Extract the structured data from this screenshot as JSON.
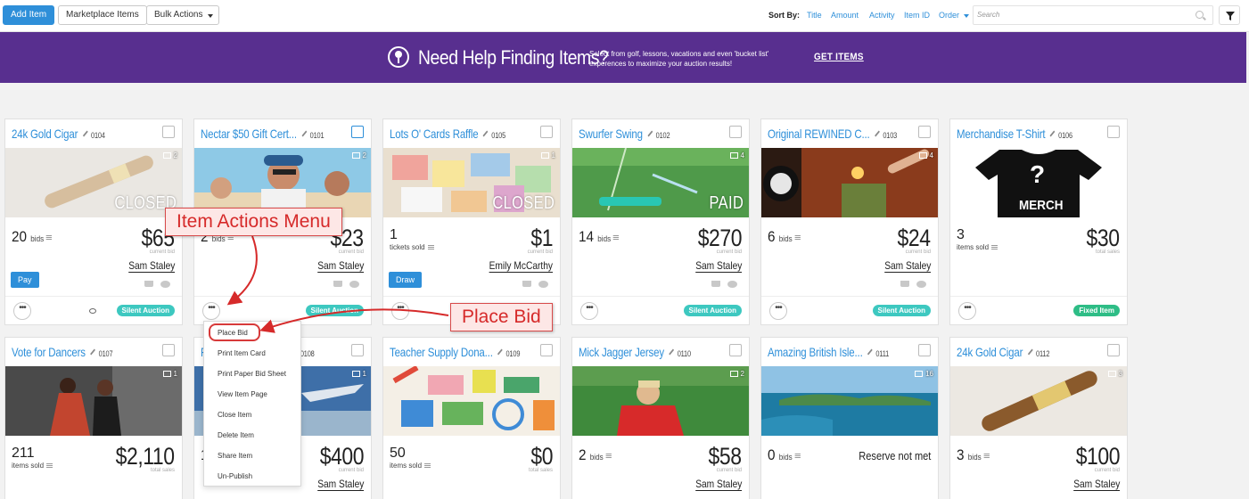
{
  "toolbar": {
    "add_item": "Add Item",
    "marketplace_items": "Marketplace Items",
    "bulk_actions": "Bulk Actions",
    "sort_by_label": "Sort By:",
    "sort_options": [
      "Title",
      "Amount",
      "Activity",
      "Item ID",
      "Order"
    ],
    "search_placeholder": "Search"
  },
  "banner": {
    "title": "Need Help Finding Items?",
    "subtitle": "Select from golf, lessons, vacations and even 'bucket list' experences to maximize your auction results!",
    "link": "GET ITEMS"
  },
  "cards": [
    {
      "title": "24k Gold Cigar",
      "num": "0104",
      "images": "2",
      "overlay": "CLOSED",
      "count": "20",
      "count_label": "bids",
      "amount": "$65",
      "amount_label": "current bid",
      "bidder": "Sam Staley",
      "action": "Pay",
      "badge": "Silent Auction"
    },
    {
      "title": "Nectar $50 Gift Cert...",
      "num": "0101",
      "images": "2",
      "overlay": "",
      "count": "2",
      "count_label": "bids",
      "amount": "$23",
      "amount_label": "current bid",
      "bidder": "Sam Staley",
      "action": "",
      "badge": "Silent Auction"
    },
    {
      "title": "Lots O' Cards Raffle",
      "num": "0105",
      "images": "1",
      "overlay": "CLOSED",
      "count": "1",
      "count_label": "tickets sold",
      "amount": "$1",
      "amount_label": "current bid",
      "bidder": "Emily McCarthy",
      "action": "Draw",
      "badge": ""
    },
    {
      "title": "Swurfer Swing",
      "num": "0102",
      "images": "4",
      "overlay": "PAID",
      "count": "14",
      "count_label": "bids",
      "amount": "$270",
      "amount_label": "current bid",
      "bidder": "Sam Staley",
      "action": "",
      "badge": "Silent Auction"
    },
    {
      "title": "Original REWINED C...",
      "num": "0103",
      "images": "4",
      "overlay": "",
      "count": "6",
      "count_label": "bids",
      "amount": "$24",
      "amount_label": "current bid",
      "bidder": "Sam Staley",
      "action": "",
      "badge": "Silent Auction"
    },
    {
      "title": "Merchandise T-Shirt",
      "num": "0106",
      "images": "",
      "overlay": "",
      "count": "3",
      "count_label": "items sold",
      "amount": "$30",
      "amount_label": "total sales",
      "bidder": "",
      "action": "",
      "badge": "Fixed Item",
      "shirt_q": "?",
      "shirt_text": "MERCH"
    },
    {
      "title": "Vote for Dancers",
      "num": "0107",
      "images": "1",
      "count": "211",
      "count_label": "items sold",
      "amount": "$2,110",
      "amount_label": "total sales",
      "bidder": ""
    },
    {
      "title": "F",
      "num": "0108",
      "images": "1",
      "count": "1",
      "count_label": "",
      "amount": "$400",
      "amount_label": "current bid",
      "bidder": "Sam Staley"
    },
    {
      "title": "Teacher Supply Dona...",
      "num": "0109",
      "images": "",
      "count": "50",
      "count_label": "items sold",
      "amount": "$0",
      "amount_label": "total sales",
      "bidder": ""
    },
    {
      "title": "Mick Jagger Jersey",
      "num": "0110",
      "images": "2",
      "count": "2",
      "count_label": "bids",
      "amount": "$58",
      "amount_label": "current bid",
      "bidder": "Sam Staley"
    },
    {
      "title": "Amazing British Isle...",
      "num": "0111",
      "images": "16",
      "count": "0",
      "count_label": "bids",
      "amount": "",
      "reserve": "Reserve not met",
      "amount_label": "",
      "bidder": ""
    },
    {
      "title": "24k Gold Cigar",
      "num": "0112",
      "images": "3",
      "count": "3",
      "count_label": "bids",
      "amount": "$100",
      "amount_label": "current bid",
      "bidder": "Sam Staley"
    }
  ],
  "dropdown": [
    "Place Bid",
    "Print Item Card",
    "Print Paper Bid Sheet",
    "View Item Page",
    "Close Item",
    "Delete Item",
    "Share Item",
    "Un-Publish"
  ],
  "annotations": {
    "item_actions_menu": "Item Actions Menu",
    "place_bid": "Place Bid"
  },
  "colors": {
    "accent": "#2e8fd9",
    "banner": "#582f8f",
    "badge": "#3dc8c0",
    "badge_fixed": "#2ebd86",
    "annotation": "#d62a2a"
  }
}
